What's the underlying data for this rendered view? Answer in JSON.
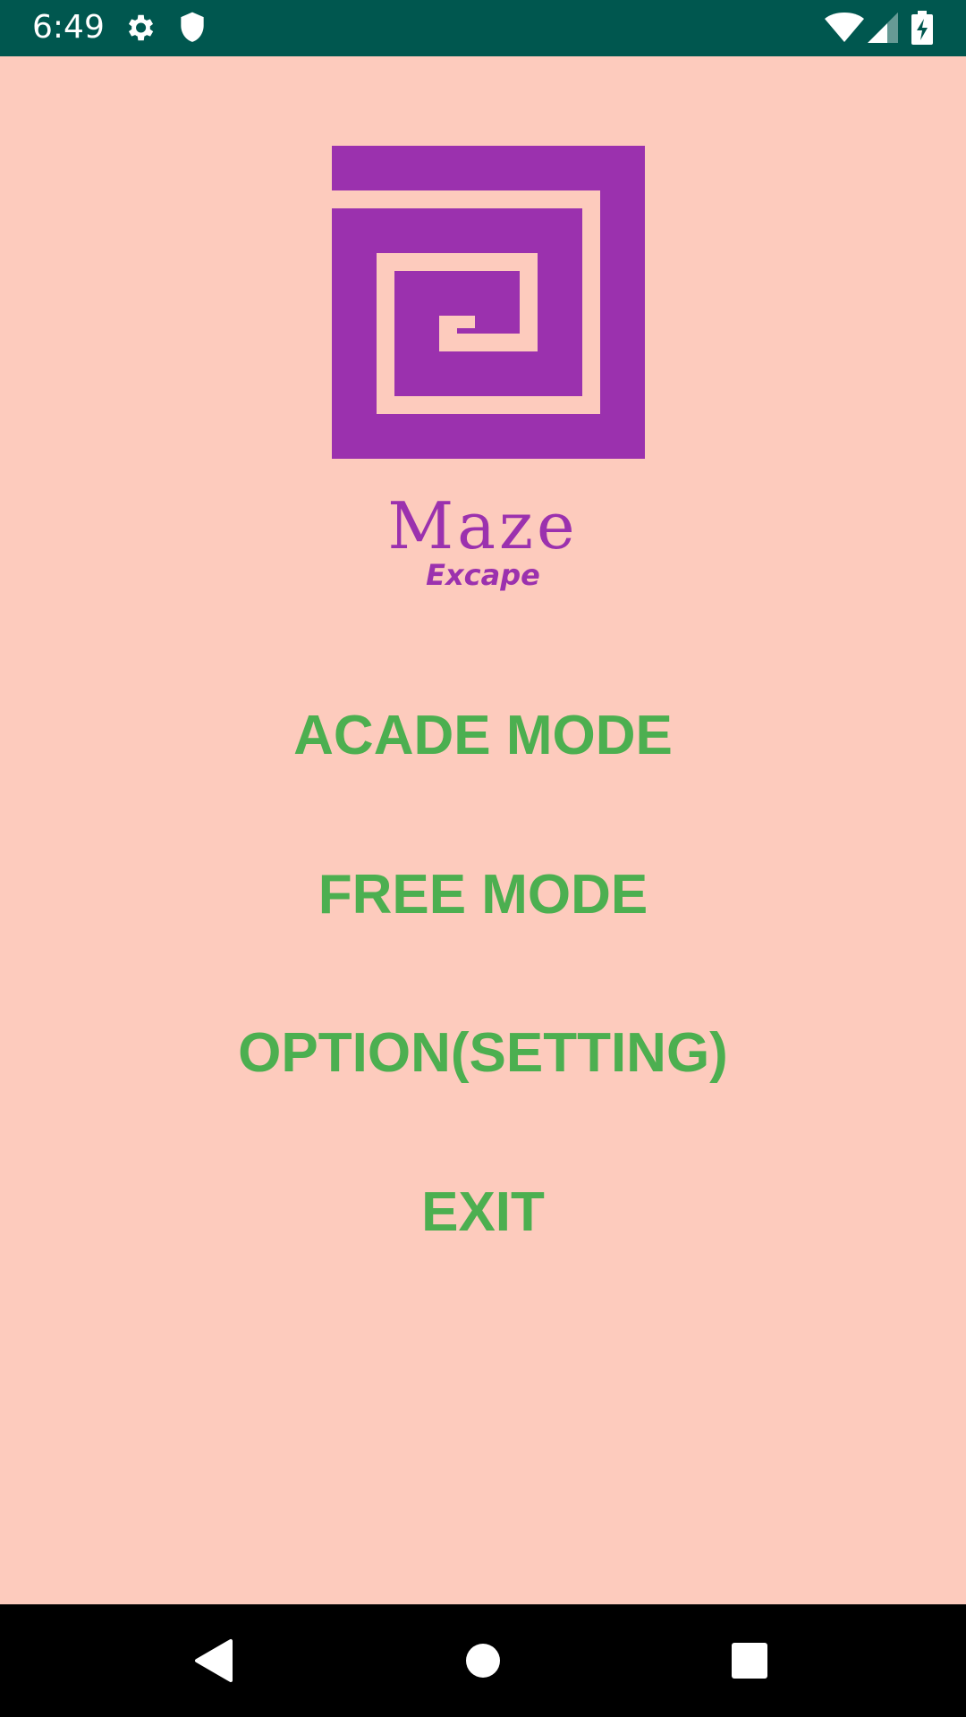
{
  "status_bar": {
    "time": "6:49",
    "icons": [
      "gear-icon",
      "shield-icon",
      "wifi-icon",
      "signal-icon",
      "battery-charging-icon"
    ],
    "background": "#00574F"
  },
  "app": {
    "background": "#FDCBBD",
    "logo": {
      "title": "Maze",
      "subtitle": "Excape",
      "color": "#9B31AE"
    }
  },
  "menu": {
    "color": "#4CAF50",
    "items": [
      {
        "label": "ACADE MODE"
      },
      {
        "label": "FREE MODE"
      },
      {
        "label": "OPTION(SETTING)"
      },
      {
        "label": "EXIT"
      }
    ]
  },
  "nav_bar": {
    "icons": [
      "back-icon",
      "home-icon",
      "recents-icon"
    ]
  }
}
